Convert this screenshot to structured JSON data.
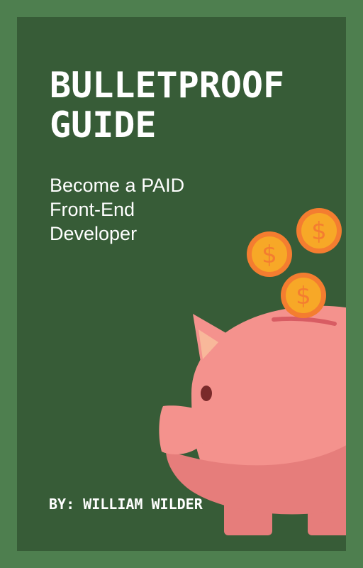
{
  "cover": {
    "title_line1": "BULLETPROOF",
    "title_line2": "GUIDE",
    "subtitle_line1": "Become a PAID",
    "subtitle_line2": "Front-End",
    "subtitle_line3": "Developer",
    "author": "BY: WILLIAM WILDER",
    "colors": {
      "frame": "#4e7f4f",
      "panel": "#375c37",
      "text": "#ffffff",
      "pig": "#f4928d",
      "pig_shadow": "#e67d7b",
      "coin": "#f7a827",
      "coin_symbol": "#f47d30"
    },
    "icons": [
      "piggy-bank-icon",
      "coin-icon",
      "coin-icon",
      "coin-icon"
    ]
  }
}
